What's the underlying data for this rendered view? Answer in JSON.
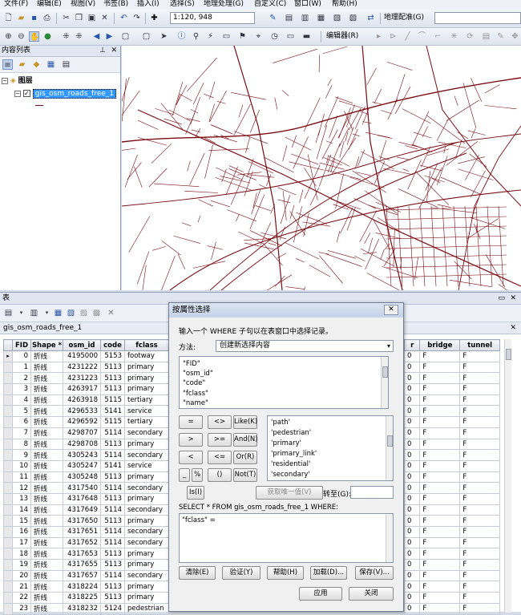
{
  "menu": [
    "文件(F)",
    "编辑(E)",
    "视图(V)",
    "书签(B)",
    "插入(I)",
    "选择(S)",
    "地理处理(G)",
    "自定义(C)",
    "窗口(W)",
    "帮助(H)"
  ],
  "toolbar1": {
    "scale": "1:120, 948",
    "georef_label": "地理配准(G)"
  },
  "toolbar2": {
    "editor_label": "编辑器(R)"
  },
  "toc": {
    "title": "内容列表",
    "root": "图层",
    "layer": "gis_osm_roads_free_1"
  },
  "colors": {
    "road": "#7a0c12",
    "selection": "#3399ff"
  },
  "table_window": {
    "title": "表",
    "tab": "gis_osm_roads_free_1",
    "columns_left": [
      "FID",
      "Shape *",
      "osm_id",
      "code",
      "fclass"
    ],
    "columns_right": [
      "r",
      "bridge",
      "tunnel"
    ],
    "rows": [
      {
        "fid": "0",
        "shape": "折线",
        "osm_id": "4195000",
        "code": "5153",
        "fclass": "footway",
        "r": "0",
        "bridge": "F",
        "tunnel": "F"
      },
      {
        "fid": "1",
        "shape": "折线",
        "osm_id": "4231222",
        "code": "5113",
        "fclass": "primary",
        "r": "0",
        "bridge": "F",
        "tunnel": "F"
      },
      {
        "fid": "2",
        "shape": "折线",
        "osm_id": "4231223",
        "code": "5113",
        "fclass": "primary",
        "r": "0",
        "bridge": "F",
        "tunnel": "F"
      },
      {
        "fid": "3",
        "shape": "折线",
        "osm_id": "4263917",
        "code": "5113",
        "fclass": "primary",
        "r": "0",
        "bridge": "F",
        "tunnel": "F"
      },
      {
        "fid": "4",
        "shape": "折线",
        "osm_id": "4263918",
        "code": "5115",
        "fclass": "tertiary",
        "r": "0",
        "bridge": "F",
        "tunnel": "F"
      },
      {
        "fid": "5",
        "shape": "折线",
        "osm_id": "4296533",
        "code": "5141",
        "fclass": "service",
        "r": "0",
        "bridge": "F",
        "tunnel": "F"
      },
      {
        "fid": "6",
        "shape": "折线",
        "osm_id": "4296592",
        "code": "5115",
        "fclass": "tertiary",
        "r": "0",
        "bridge": "F",
        "tunnel": "F"
      },
      {
        "fid": "7",
        "shape": "折线",
        "osm_id": "4298707",
        "code": "5114",
        "fclass": "secondary",
        "r": "0",
        "bridge": "F",
        "tunnel": "F"
      },
      {
        "fid": "8",
        "shape": "折线",
        "osm_id": "4298708",
        "code": "5113",
        "fclass": "primary",
        "r": "0",
        "bridge": "F",
        "tunnel": "F"
      },
      {
        "fid": "9",
        "shape": "折线",
        "osm_id": "4305243",
        "code": "5114",
        "fclass": "secondary",
        "r": "0",
        "bridge": "F",
        "tunnel": "F"
      },
      {
        "fid": "10",
        "shape": "折线",
        "osm_id": "4305247",
        "code": "5141",
        "fclass": "service",
        "r": "0",
        "bridge": "F",
        "tunnel": "F"
      },
      {
        "fid": "11",
        "shape": "折线",
        "osm_id": "4305248",
        "code": "5113",
        "fclass": "primary",
        "r": "0",
        "bridge": "F",
        "tunnel": "F"
      },
      {
        "fid": "12",
        "shape": "折线",
        "osm_id": "4317540",
        "code": "5114",
        "fclass": "secondary",
        "r": "0",
        "bridge": "F",
        "tunnel": "F"
      },
      {
        "fid": "13",
        "shape": "折线",
        "osm_id": "4317648",
        "code": "5113",
        "fclass": "primary",
        "r": "0",
        "bridge": "F",
        "tunnel": "F"
      },
      {
        "fid": "14",
        "shape": "折线",
        "osm_id": "4317649",
        "code": "5114",
        "fclass": "secondary",
        "r": "0",
        "bridge": "F",
        "tunnel": "F"
      },
      {
        "fid": "15",
        "shape": "折线",
        "osm_id": "4317650",
        "code": "5113",
        "fclass": "primary",
        "r": "0",
        "bridge": "F",
        "tunnel": "F"
      },
      {
        "fid": "16",
        "shape": "折线",
        "osm_id": "4317651",
        "code": "5114",
        "fclass": "secondary",
        "r": "0",
        "bridge": "F",
        "tunnel": "F"
      },
      {
        "fid": "17",
        "shape": "折线",
        "osm_id": "4317652",
        "code": "5114",
        "fclass": "secondary",
        "r": "0",
        "bridge": "F",
        "tunnel": "F"
      },
      {
        "fid": "18",
        "shape": "折线",
        "osm_id": "4317653",
        "code": "5113",
        "fclass": "primary",
        "r": "0",
        "bridge": "F",
        "tunnel": "F"
      },
      {
        "fid": "19",
        "shape": "折线",
        "osm_id": "4317655",
        "code": "5113",
        "fclass": "primary",
        "r": "0",
        "bridge": "F",
        "tunnel": "F"
      },
      {
        "fid": "20",
        "shape": "折线",
        "osm_id": "4317657",
        "code": "5114",
        "fclass": "secondary",
        "r": "0",
        "bridge": "F",
        "tunnel": "F"
      },
      {
        "fid": "21",
        "shape": "折线",
        "osm_id": "4318224",
        "code": "5113",
        "fclass": "primary",
        "r": "0",
        "bridge": "F",
        "tunnel": "F"
      },
      {
        "fid": "22",
        "shape": "折线",
        "osm_id": "4318225",
        "code": "5113",
        "fclass": "primary",
        "r": "0",
        "bridge": "F",
        "tunnel": "F"
      },
      {
        "fid": "23",
        "shape": "折线",
        "osm_id": "4318232",
        "code": "5124",
        "fclass": "pedestrian",
        "r": "0",
        "bridge": "F",
        "tunnel": "F"
      }
    ]
  },
  "dialog": {
    "title": "按属性选择",
    "instruction": "输入一个 WHERE 子句以在表窗口中选择记录。",
    "method_label": "方法:",
    "method_value": "创建新选择内容",
    "fields": [
      "\"FID\"",
      "\"osm_id\"",
      "\"code\"",
      "\"fclass\"",
      "\"name\""
    ],
    "values": [
      "'path'",
      "'pedestrian'",
      "'primary'",
      "'primary_link'",
      "'residential'",
      "'secondary'"
    ],
    "operators": [
      "=",
      "<>",
      "Like(K)",
      ">",
      ">=",
      "And(N)",
      "<",
      "<=",
      "Or(R)",
      "_",
      "%",
      "()",
      "Not(T)"
    ],
    "is_label": "Is(I)",
    "unique_label": "获取唯一值(V)",
    "goto_label": "转至(G):",
    "select_from": "SELECT * FROM gis_osm_roads_free_1 WHERE:",
    "where_text": "\"fclass\" =",
    "btn_clear": "清除(E)",
    "btn_verify": "验证(Y)",
    "btn_help": "帮助(H)",
    "btn_load": "加载(D)...",
    "btn_save": "保存(V)...",
    "btn_apply": "应用",
    "btn_close": "关闭"
  }
}
